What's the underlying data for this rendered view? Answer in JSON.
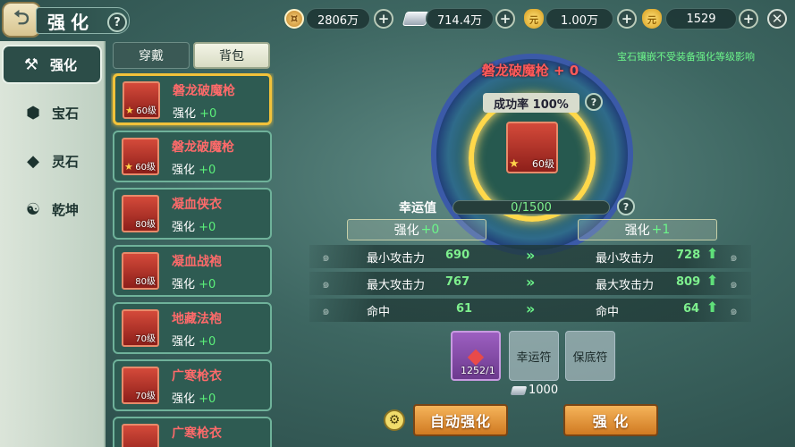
{
  "header": {
    "title": "强化",
    "help": "?"
  },
  "currencies": [
    {
      "name": "coin",
      "icon": "copper-coin-icon",
      "value": "2806万"
    },
    {
      "name": "silver",
      "icon": "silver-ingot-icon",
      "value": "714.4万"
    },
    {
      "name": "gold-ingot",
      "icon": "gold-ingot-icon",
      "value": "1.00万"
    },
    {
      "name": "gold-bar",
      "icon": "gold-bar-icon",
      "value": "1529"
    }
  ],
  "sidebar": {
    "items": [
      {
        "label": "强化",
        "icon": "anvil-icon",
        "active": true
      },
      {
        "label": "宝石",
        "icon": "gem-icon",
        "active": false
      },
      {
        "label": "灵石",
        "icon": "spirit-stone-icon",
        "active": false
      },
      {
        "label": "乾坤",
        "icon": "yin-yang-icon",
        "active": false
      }
    ]
  },
  "subtabs": [
    {
      "label": "穿戴",
      "active": false
    },
    {
      "label": "背包",
      "active": true
    }
  ],
  "items": [
    {
      "name": "磐龙破魔枪",
      "level": "60级",
      "star": "★",
      "enhance_label": "强化",
      "enhance_value": "+0",
      "selected": true
    },
    {
      "name": "磐龙破魔枪",
      "level": "60级",
      "star": "★",
      "enhance_label": "强化",
      "enhance_value": "+0",
      "selected": false
    },
    {
      "name": "凝血侠衣",
      "level": "80级",
      "star": "",
      "enhance_label": "强化",
      "enhance_value": "+0",
      "selected": false
    },
    {
      "name": "凝血战袍",
      "level": "80级",
      "star": "",
      "enhance_label": "强化",
      "enhance_value": "+0",
      "selected": false
    },
    {
      "name": "地藏法袍",
      "level": "70级",
      "star": "",
      "enhance_label": "强化",
      "enhance_value": "+0",
      "selected": false
    },
    {
      "name": "广寒枪衣",
      "level": "70级",
      "star": "",
      "enhance_label": "强化",
      "enhance_value": "+0",
      "selected": false
    },
    {
      "name": "广寒枪衣",
      "level": "",
      "star": "",
      "enhance_label": "",
      "enhance_value": "",
      "selected": false
    }
  ],
  "forge": {
    "title": "磐龙破魔枪 + 0",
    "success_rate": "成功率 100%",
    "item_level": "60级",
    "item_star": "★",
    "notice": "宝石镶嵌不受装备强化等级影响",
    "lucky_label": "幸运值",
    "lucky_value": "0/1500",
    "lucky_fraction": 0
  },
  "compare": {
    "left": {
      "label": "强化",
      "value": "+0"
    },
    "right": {
      "label": "强化",
      "value": "+1"
    }
  },
  "stats": [
    {
      "name": "最小攻击力",
      "before": "690",
      "after": "728"
    },
    {
      "name": "最大攻击力",
      "before": "767",
      "after": "809"
    },
    {
      "name": "命中",
      "before": "61",
      "after": "64"
    }
  ],
  "materials": {
    "stone_count": "1252/1",
    "lucky_charm": "幸运符",
    "protect_charm": "保底符",
    "cost": "1000"
  },
  "buttons": {
    "auto": "自动强化",
    "enhance": "强 化"
  },
  "colors": {
    "accent_gold": "#f2c23a",
    "green_value": "#7ef08e",
    "red_name": "#ff6a6a"
  }
}
